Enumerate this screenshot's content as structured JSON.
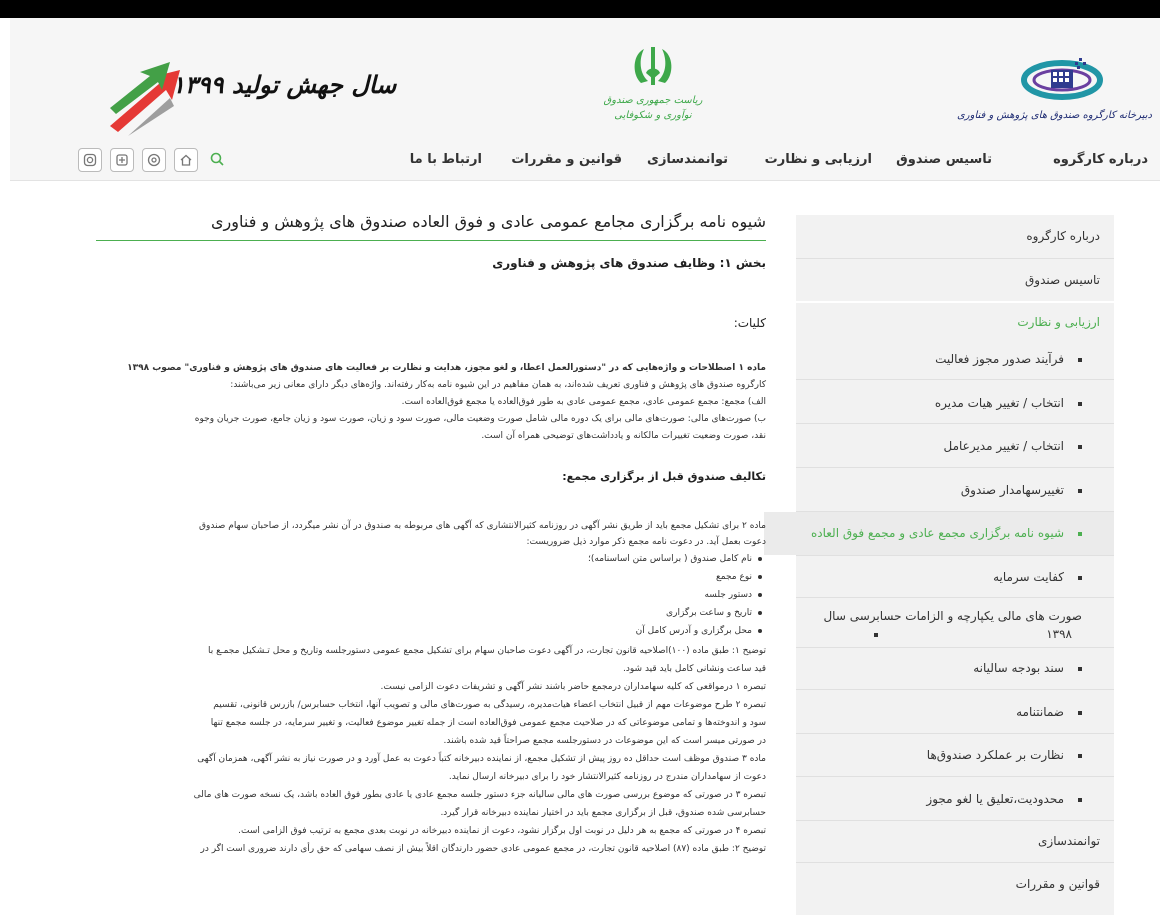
{
  "header": {
    "logo_right_text": "دبیرخانه کارگروه صندوق های پژوهش و فناوری",
    "logo_center_text": "ریاست جمهوری صندوق نوآوری و شکوفایی",
    "logo_left_text": "سال جهش تولید ۱۳۹۹"
  },
  "nav": {
    "items": [
      "درباره کارگروه",
      "تاسیس صندوق",
      "ارزیابی و نظارت",
      "توانمندسازی",
      "قوانین و مقررات",
      "ارتباط با ما"
    ],
    "icons": [
      "search-icon",
      "home-icon",
      "telegram-icon",
      "aparat-icon",
      "instagram-icon"
    ]
  },
  "sidebar": {
    "items": [
      "درباره کارگروه",
      "تاسیس صندوق",
      "ارزیابی و نظارت",
      "فرآیند صدور مجوز فعالیت",
      "انتخاب / تغییر هیات مدیره",
      "انتخاب / تغییر مدیرعامل",
      "تغییرسهامدار صندوق",
      "شیوه نامه برگزاری مجمع عادی و مجمع فوق العاده",
      "کفایت سرمایه",
      "صورت های مالی یکپارچه و الزامات حسابرسی سال",
      "۱۳۹۸",
      "سند بودجه سالیانه",
      "ضمانتنامه",
      "نظارت بر عملکرد صندوق‌ها",
      "محدودیت،تعلیق یا لغو مجوز",
      "توانمندسازی",
      "قوانین و مقررات"
    ],
    "accent_color": "#4caf50"
  },
  "content": {
    "title": "شیوه نامه برگزاری مجامع عمومی عادی و فوق العاده صندوق های پژوهش و فناوری",
    "section1": "بخش ۱: وظایف صندوق های پژوهش و فناوری",
    "generalities": "کلیات:",
    "p1": [
      "ماده ۱ اصطلاحات و واژه‌هایی که در \"دستورالعمل اعطا، و لغو مجوز، هدایت و نظارت بر فعالیت های صندوق های پژوهش و فناوری\" مصوب ۱۳۹۸",
      "کارگروه صندوق های پژوهش و فناوری تعریف شده‌اند، به همان مفاهیم در این شیوه نامه به‌کار رفته‌اند. واژه‌های دیگر دارای معانی زیر می‌باشند:",
      "الف) مجمع: مجمع عمومی عادی، مجمع عمومی عادی به طور فوق‌العاده یا مجمع فوق‌العاده است.",
      "ب) صورت‌های مالی: صورت‌های مالی برای یک دوره مالی شامل صورت وضعیت مالی، صورت سود و زیان، صورت سود و زیان جامع، صورت جریان وجوه",
      "نقد، صورت وضعیت تغییرات مالکانه و یادداشت‌های توضیحی همراه آن است."
    ],
    "section2": "تکالیف صندوق قبل از برگزاری مجمع:",
    "p2": [
      "ماده ۲ برای تشکیل مجمع باید از طریق نشر آگهی در روزنامه کثیرالانتشاری که آگهی های مربوطه به صندوق در آن نشر میگردد، از صاحبان سهام صندوق",
      "دعوت بعمل آید. در دعوت نامه مجمع ذکر موارد ذیل ضروریست:"
    ],
    "bullets": [
      "نام کامل صندوق ( براساس متن اساسنامه)؛",
      "نوع مجمع",
      "دستور جلسه",
      "تاریخ و ساعت برگزاری",
      "محل برگزاری و آدرس کامل آن"
    ],
    "p3": [
      "توضیح ۱: طبق ماده (۱۰۰)اصلاحیه قانون تجارت، در آگهی دعوت صاحبان سهام برای تشکیل مجمع عمومی دستورجلسه وتاریخ و محل تـشکیل مجمـع با",
      "قید ساعت ونشانی کامل باید قید شود.",
      "تبصره ۱ درمواقعی که کلیه سهامداران درمجمع حاضر باشند نشر آگهی و تشریفات دعوت الزامی نیست.",
      "تبصره ۲ طرح موضوعات مهم از قبیل انتخاب اعضاء هیات‌مدیره، رسیدگی به صورت‌های مالی و تصویب آنها، انتخاب حسابرس/ بازرس قانونی، تقسیم",
      "سود و اندوخته‌ها و تمامی موضوعاتی که در صلاحیت مجمع عمومی فوق‌العاده است از جمله تغییر موضوع فعالیت، و تغییر سرمایه، در جلسه مجمع تنها",
      "در صورتی میسر است که این موضوعات در دستورجلسه مجمع صراحتاً قید شده باشند.",
      "ماده ۳ صندوق موظف است حداقل ده روز پیش از تشکیل مجمع، از نماینده دبیرخانه کتباً دعوت به عمل آورد و در صورت نیاز به نشر آگهی، همزمان آگهی",
      "دعوت از سهامداران مندرج در روزنامه کثیرالانتشار خود را برای دبیرخانه ارسال نماید.",
      "تبصره ۳ در صورتی که موضوع بررسی صورت های مالی سالیانه جزء دستور جلسه مجمع عادی یا عادی بطور فوق العاده باشد، یک نسخه صورت های مالی",
      "حسابرسی شده صندوق، قبل از برگزاری مجمع باید در اختیار نماینده دبیرخانه قرار گیرد.",
      "تبصره ۴ در صورتی که مجمع به هر دلیل در نوبت اول برگزار نشود، دعوت از نماینده دبیرخانه در نوبت بعدی مجمع به ترتیب فوق الزامی است.",
      "توضیح ۲: طبق ماده (۸۷) اصلاحیه قانون تجارت، در مجمع عمومی عادی حضور دارندگان اقلاً بیش از نصف سهامی که حق رأی دارند ضروری است اگر در"
    ]
  }
}
